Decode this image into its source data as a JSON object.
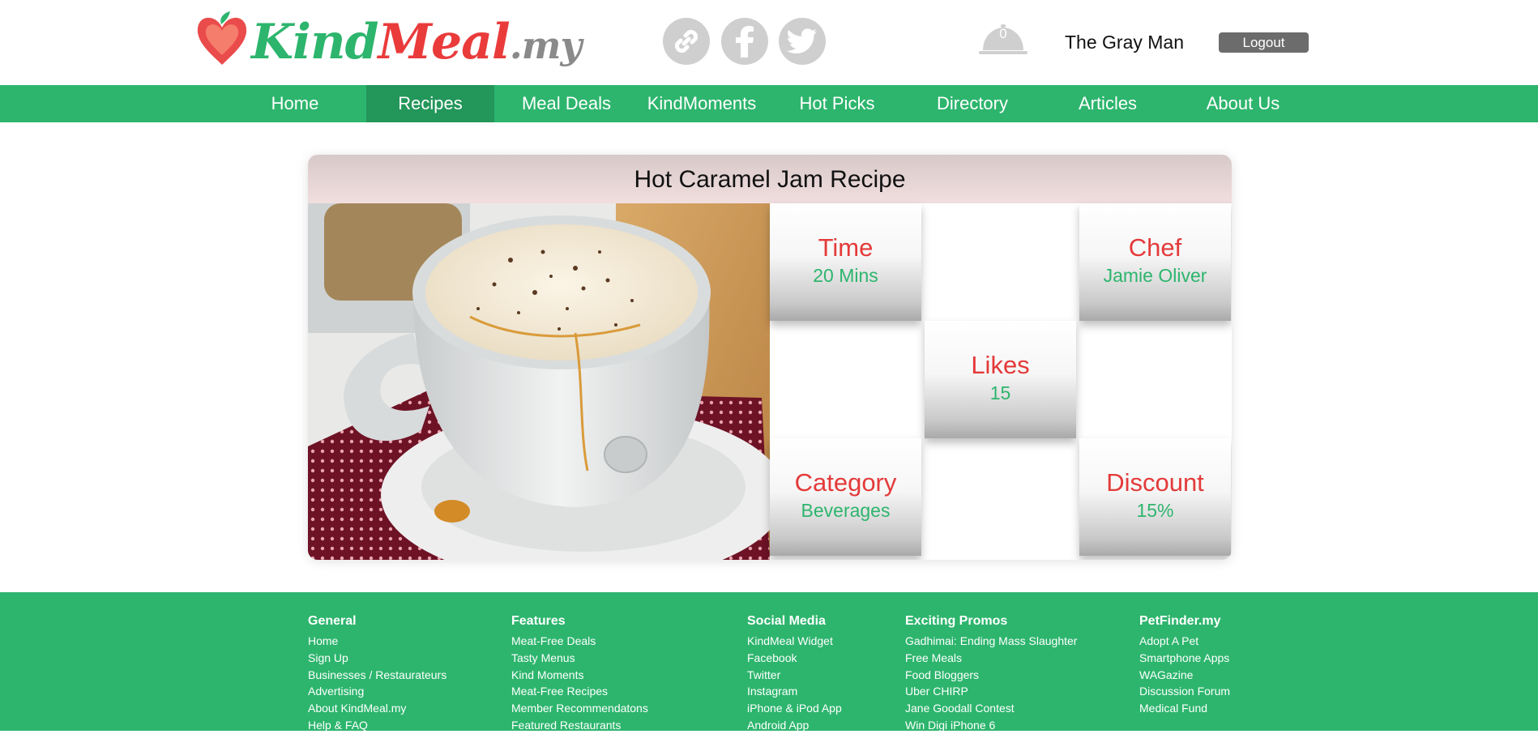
{
  "brand": {
    "logo_parts": [
      "Kind",
      "Meal",
      ".my"
    ],
    "colors": {
      "green": "#2db56d",
      "red": "#ea3b3b",
      "gray": "#8a8a8a"
    }
  },
  "header": {
    "social_icons": [
      "link-icon",
      "facebook-icon",
      "twitter-icon"
    ],
    "notifications": {
      "icon": "cloche-icon",
      "count": "0"
    },
    "username": "The Gray Man",
    "logout_label": "Logout"
  },
  "nav": {
    "items": [
      {
        "label": "Home",
        "active": false
      },
      {
        "label": "Recipes",
        "active": true
      },
      {
        "label": "Meal Deals",
        "active": false
      },
      {
        "label": "KindMoments",
        "active": false
      },
      {
        "label": "Hot Picks",
        "active": false
      },
      {
        "label": "Directory",
        "active": false
      },
      {
        "label": "Articles",
        "active": false
      },
      {
        "label": "About Us",
        "active": false
      }
    ]
  },
  "recipe": {
    "title": "Hot Caramel Jam Recipe",
    "image": "coffee-cup-photo",
    "stats": {
      "time": {
        "label": "Time",
        "value": "20 Mins"
      },
      "chef": {
        "label": "Chef",
        "value": "Jamie Oliver"
      },
      "likes": {
        "label": "Likes",
        "value": "15"
      },
      "category": {
        "label": "Category",
        "value": "Beverages"
      },
      "discount": {
        "label": "Discount",
        "value": "15%"
      }
    }
  },
  "footer": {
    "columns": [
      {
        "heading": "General",
        "links": [
          "Home",
          "Sign Up",
          "Businesses / Restaurateurs",
          "Advertising",
          "About KindMeal.my",
          "Help & FAQ"
        ]
      },
      {
        "heading": "Features",
        "links": [
          "Meat-Free Deals",
          "Tasty Menus",
          "Kind Moments",
          "Meat-Free Recipes",
          "Member Recommendatons",
          "Featured Restaurants"
        ]
      },
      {
        "heading": "Social Media",
        "links": [
          "KindMeal Widget",
          "Facebook",
          "Twitter",
          "Instagram",
          "iPhone & iPod App",
          "Android App"
        ]
      },
      {
        "heading": "Exciting Promos",
        "links": [
          "Gadhimai: Ending Mass Slaughter",
          "Free Meals",
          "Food Bloggers",
          "Uber CHIRP",
          "Jane Goodall Contest",
          "Win Digi iPhone 6"
        ]
      },
      {
        "heading": "PetFinder.my",
        "links": [
          "Adopt A Pet",
          "Smartphone Apps",
          "WAGazine",
          "Discussion Forum",
          "Medical Fund"
        ]
      }
    ]
  }
}
